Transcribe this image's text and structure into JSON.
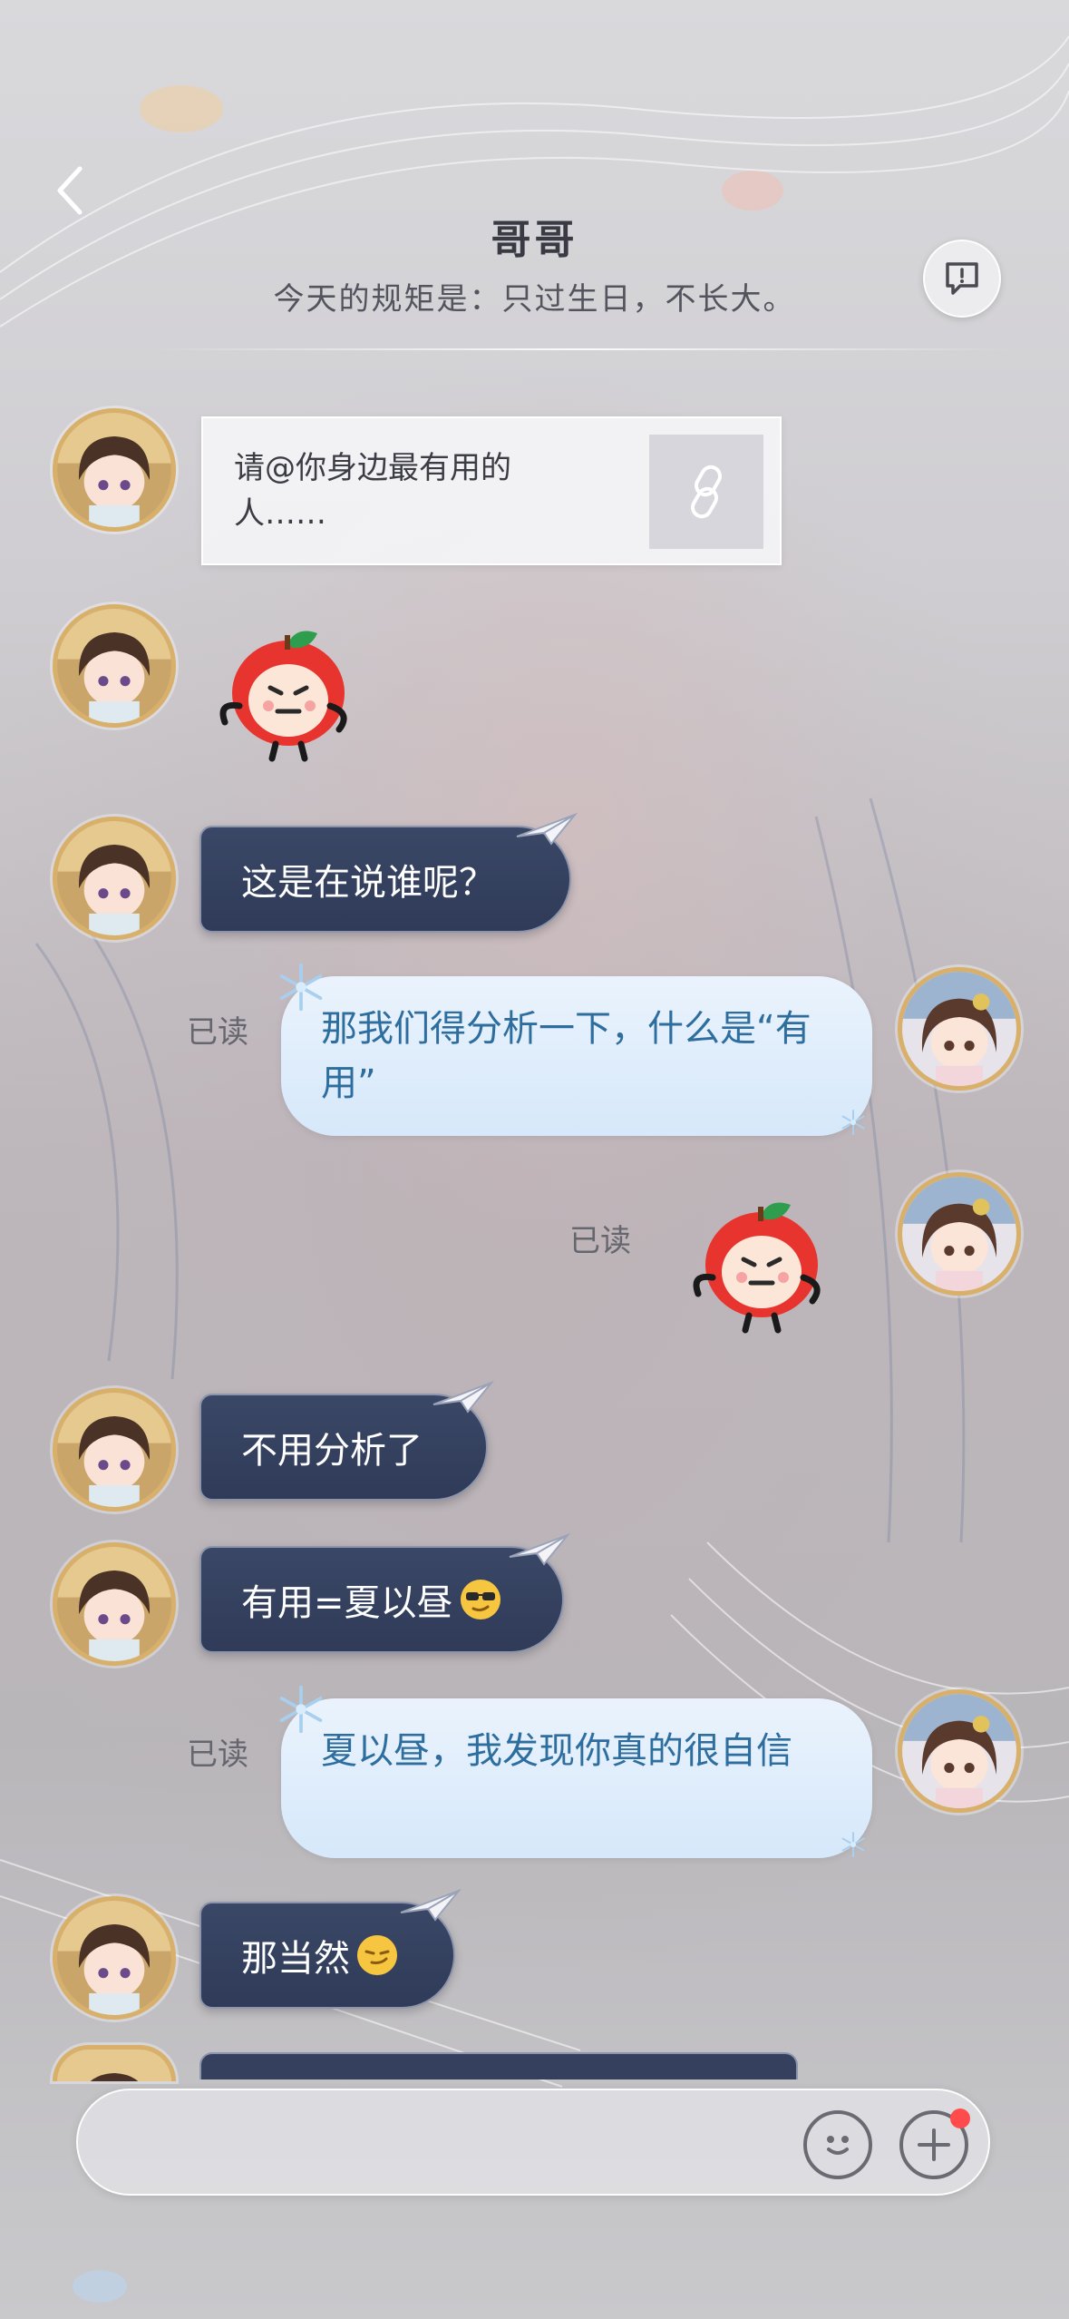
{
  "header": {
    "title": "哥哥",
    "subtitle": "今天的规矩是：只过生日，不长大。",
    "back_icon": "chevron-left-icon",
    "action_icon": "chat-bubble-icon"
  },
  "messages": [
    {
      "side": "left",
      "type": "card",
      "text": "请@你身边最有用的人……",
      "icon": "link-icon"
    },
    {
      "side": "left",
      "type": "sticker",
      "sticker": "angry-apple"
    },
    {
      "side": "left",
      "type": "text",
      "text": "这是在说谁呢？"
    },
    {
      "side": "right",
      "type": "text",
      "text": "那我们得分析一下，什么是“有用”",
      "status": "已读"
    },
    {
      "side": "right",
      "type": "sticker",
      "sticker": "angry-apple",
      "status": "已读"
    },
    {
      "side": "left",
      "type": "text",
      "text": "不用分析了"
    },
    {
      "side": "left",
      "type": "text",
      "text": "有用=夏以昼",
      "emoji": "sunglasses-emoji"
    },
    {
      "side": "right",
      "type": "text",
      "text": "夏以昼，我发现你真的很自信",
      "status": "已读"
    },
    {
      "side": "left",
      "type": "text",
      "text": "那当然",
      "emoji": "smirk-emoji"
    }
  ],
  "input_bar": {
    "placeholder": "",
    "emoji_icon": "smiley-icon",
    "plus_icon": "plus-icon",
    "has_badge": true
  },
  "colors": {
    "dark_bubble": "#34405e",
    "light_bubble": "#dceafa",
    "light_text": "#2e6e9e",
    "badge": "#ff4b4b"
  }
}
